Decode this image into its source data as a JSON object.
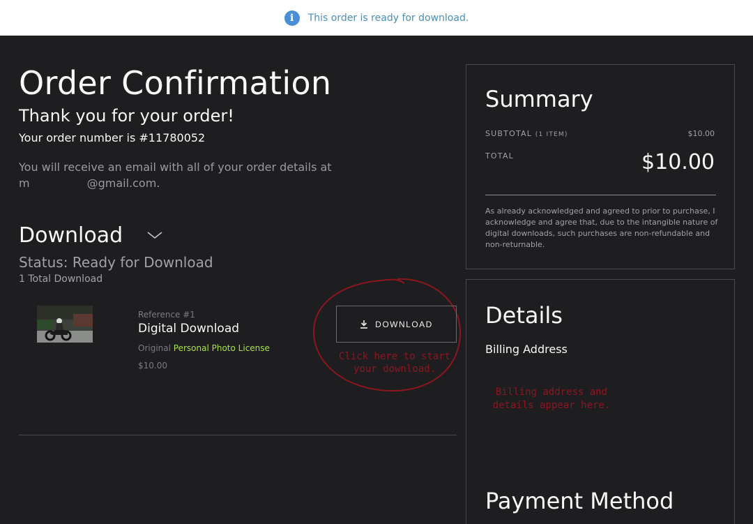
{
  "notice": {
    "text": "This order is ready for download.",
    "icon": "info-icon",
    "icon_glyph": "i"
  },
  "confirmation": {
    "title": "Order Confirmation",
    "thanks": "Thank you for your order!",
    "order_number_text": "Your order number is #11780052",
    "email_note_prefix": "You will receive an email with all of your order details at",
    "email_start": "m",
    "email_end": "@gmail.com."
  },
  "download": {
    "title": "Download",
    "status": "Status: Ready for Download",
    "total": "1 Total Download",
    "item": {
      "reference": "Reference #1",
      "name": "Digital Download",
      "license_prefix": "Original",
      "license_link": "Personal Photo License",
      "price": "$10.00"
    },
    "button_label": "DOWNLOAD",
    "annotation": "Click here to start your download."
  },
  "summary": {
    "title": "Summary",
    "subtotal_label": "SUBTOTAL",
    "subtotal_items": "(1 ITEM)",
    "subtotal_value": "$10.00",
    "total_label": "TOTAL",
    "total_value": "$10.00",
    "disclaimer": "As already acknowledged and agreed to prior to purchase, I acknowledge and agree that, due to the intangible nature of digital downloads, such purchases are non-refundable and non-returnable."
  },
  "details": {
    "title": "Details",
    "billing_label": "Billing Address",
    "billing_annotation": "Billing address and details appear here.",
    "payment_title": "Payment Method"
  },
  "colors": {
    "background": "#1e1e20",
    "accent_link": "#a8e04a",
    "annotation_red": "#8c1620",
    "info_blue": "#4a8fd6"
  }
}
